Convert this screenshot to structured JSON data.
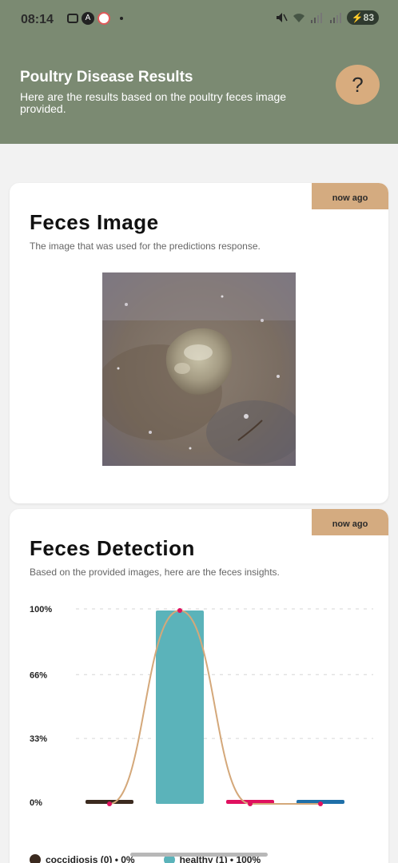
{
  "status": {
    "time": "08:14",
    "battery": "83"
  },
  "header": {
    "title": "Poultry Disease Results",
    "subtitle": "Here are the results based on the poultry feces image provided.",
    "help_label": "?"
  },
  "image_card": {
    "badge": "now ago",
    "title": "Feces Image",
    "subtitle": "The image that was used for the predictions response."
  },
  "detection_card": {
    "badge": "now ago",
    "title": "Feces Detection",
    "subtitle": "Based on the provided images, here are the feces insights."
  },
  "colors": {
    "header_bg": "#7b8a72",
    "help_btn": "#d8ac7e",
    "badge": "#d4ab80",
    "coccidiosis": "#3b2a1f",
    "healthy": "#5bb3ba",
    "third_series": "#e0115f",
    "fourth_series": "#1f6fa8",
    "trend_line": "#d4a87a"
  },
  "chart_data": {
    "type": "bar",
    "categories": [
      "coccidiosis",
      "healthy",
      "",
      ""
    ],
    "values": [
      0,
      100,
      0,
      0
    ],
    "ylim": [
      0,
      100
    ],
    "yticks": [
      "0%",
      "33%",
      "66%",
      "100%"
    ],
    "grid": true,
    "legend": [
      {
        "label": "coccidiosis (0) • 0%",
        "color": "#3b2a1f"
      },
      {
        "label": "healthy (1) • 100%",
        "color": "#5bb3ba"
      }
    ]
  }
}
